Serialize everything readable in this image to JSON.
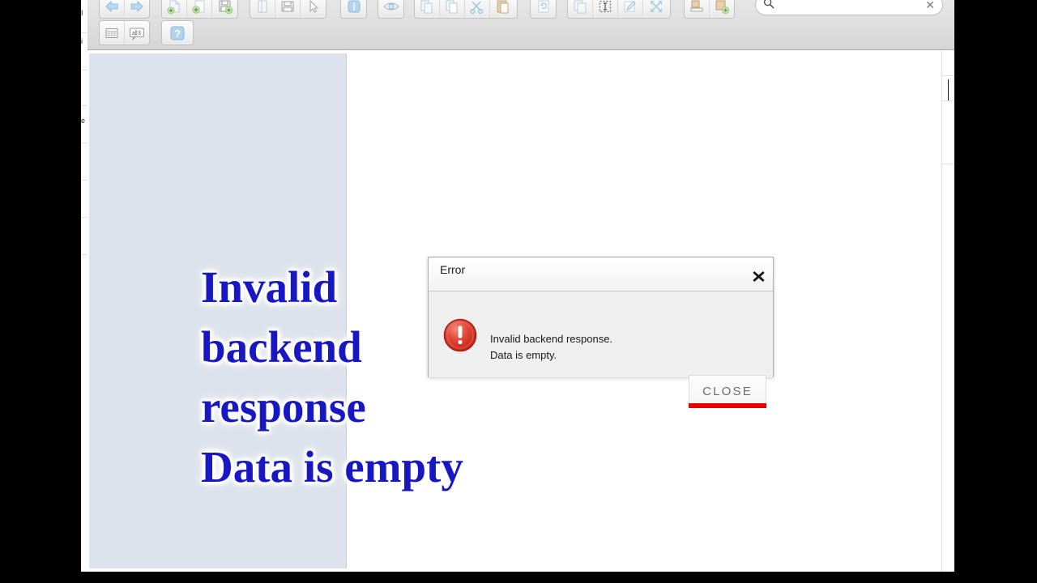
{
  "window": {
    "background_color": "#ffffff",
    "letterbox_color": "#000000"
  },
  "toolbar": {
    "background_color": "#dddddd",
    "rows": [
      {
        "groups": [
          {
            "buttons": [
              {
                "icon": "arrow-left-icon",
                "label": "Back"
              },
              {
                "icon": "arrow-right-icon",
                "label": "Forward"
              }
            ]
          },
          {
            "buttons": [
              {
                "icon": "new-document-add-icon",
                "label": "New"
              },
              {
                "icon": "page-add-icon",
                "label": "Add Page"
              },
              {
                "icon": "save-add-icon",
                "label": "Save As New"
              }
            ]
          },
          {
            "buttons": [
              {
                "icon": "book-icon",
                "label": "Open"
              },
              {
                "icon": "save-icon",
                "label": "Save"
              },
              {
                "icon": "cursor-arrow-icon",
                "label": "Select"
              }
            ]
          },
          {
            "buttons": [
              {
                "icon": "info-icon",
                "label": "Info"
              }
            ]
          },
          {
            "buttons": [
              {
                "icon": "eye-icon",
                "label": "Preview"
              }
            ]
          },
          {
            "buttons": [
              {
                "icon": "copy-pages-icon",
                "label": "Copy Pages"
              },
              {
                "icon": "copy-icon",
                "label": "Copy"
              },
              {
                "icon": "cut-scissors-icon",
                "label": "Cut"
              },
              {
                "icon": "paste-icon",
                "label": "Paste"
              }
            ]
          },
          {
            "buttons": [
              {
                "icon": "refresh-page-icon",
                "label": "Refresh"
              }
            ]
          },
          {
            "buttons": [
              {
                "icon": "duplicate-icon",
                "label": "Duplicate"
              },
              {
                "icon": "text-select-icon",
                "label": "Text Select"
              },
              {
                "icon": "edit-pencil-icon",
                "label": "Edit"
              },
              {
                "icon": "expand-arrows-icon",
                "label": "Expand"
              }
            ]
          },
          {
            "buttons": [
              {
                "icon": "export-icon",
                "label": "Export"
              },
              {
                "icon": "import-add-icon",
                "label": "Import"
              }
            ]
          }
        ]
      },
      {
        "groups": [
          {
            "buttons": [
              {
                "icon": "table-grid-icon",
                "label": "Table"
              },
              {
                "icon": "translate-icon",
                "label": "Translate"
              }
            ]
          },
          {
            "buttons": [
              {
                "icon": "help-question-icon",
                "label": "Help"
              }
            ]
          }
        ]
      }
    ]
  },
  "search": {
    "icon": "search-icon",
    "value": "",
    "placeholder": "",
    "clear_icon": "clear-x-icon",
    "clear_glyph": "✕"
  },
  "sidebar": {
    "background_color": "#dde3ec",
    "splitter": "panel-splitter"
  },
  "overlay_caption": {
    "lines": [
      "Invalid",
      "backend",
      "response",
      "Data is empty"
    ],
    "color": "#1717c4",
    "glow_color": "#ffffff"
  },
  "error_dialog": {
    "title": "Error",
    "close_icon": "close-x-icon",
    "severity_icon": "error-exclamation-icon",
    "severity_color": "#d8342a",
    "message_line1": "Invalid backend response.",
    "message_line2": "Data is empty.",
    "close_button_label": "CLOSE",
    "close_button_accent_color": "#e60000"
  }
}
